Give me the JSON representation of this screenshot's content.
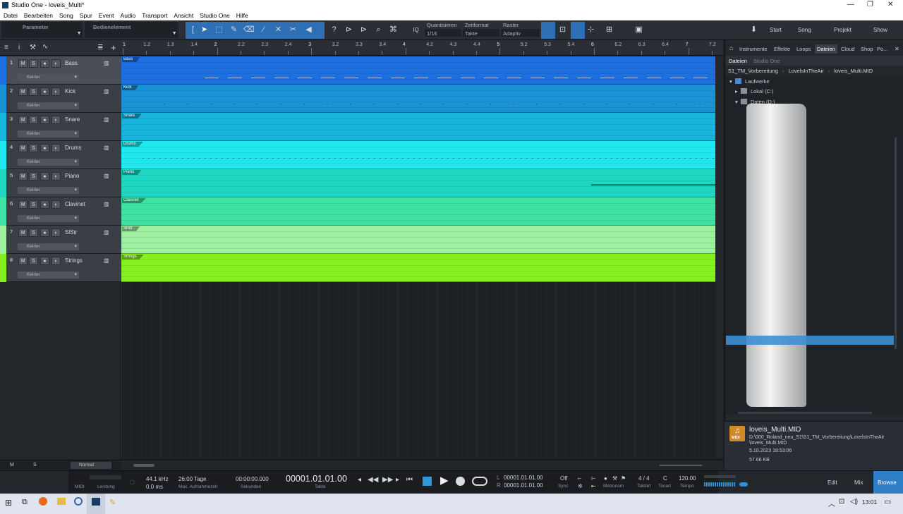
{
  "window": {
    "title": "Studio One - loveis_Multi*",
    "controls": [
      "—",
      "❐",
      "✕"
    ]
  },
  "menu": [
    "Datei",
    "Bearbeiten",
    "Song",
    "Spur",
    "Event",
    "Audio",
    "Transport",
    "Ansicht",
    "Studio One",
    "Hilfe"
  ],
  "toolbar": {
    "parameter_label": "Parameter",
    "bedienelement_label": "Bedienelement",
    "quantize": {
      "label": "Quantisieren",
      "value": "1/16"
    },
    "timeformat": {
      "label": "Zeitformat",
      "value": "Takte"
    },
    "grid": {
      "label": "Raster",
      "value": "Adaptiv"
    },
    "iq_label": "IQ",
    "nav": [
      "Start",
      "Song",
      "Projekt",
      "Show"
    ]
  },
  "tracks": [
    {
      "num": "1",
      "name": "Bass",
      "input": "Keiner",
      "color": "#1e6fe0"
    },
    {
      "num": "2",
      "name": "Kick",
      "input": "Keiner",
      "color": "#1a93d6"
    },
    {
      "num": "3",
      "name": "Snare",
      "input": "Keiner",
      "color": "#17b4dc"
    },
    {
      "num": "4",
      "name": "Drums",
      "input": "Keiner",
      "color": "#1fe8ef"
    },
    {
      "num": "5",
      "name": "Piano",
      "input": "Keiner",
      "color": "#1ed7c2"
    },
    {
      "num": "6",
      "name": "Clavinet",
      "input": "Keiner",
      "color": "#3ee2a3"
    },
    {
      "num": "7",
      "name": "SlStr",
      "input": "Keiner",
      "color": "#9ff0a0"
    },
    {
      "num": "8",
      "name": "Strings",
      "input": "Keiner",
      "color": "#86f01f"
    }
  ],
  "track_buttons": [
    "M",
    "S",
    "●",
    "◐"
  ],
  "ruler_ticks": [
    "1",
    "1.2",
    "1.3",
    "1.4",
    "2",
    "2.2",
    "2.3",
    "2.4",
    "3",
    "3.2",
    "3.3",
    "3.4",
    "4",
    "4.2",
    "4.3",
    "4.4",
    "5",
    "5.2",
    "5.3",
    "5.4",
    "6",
    "6.2",
    "6.3",
    "6.4",
    "7",
    "7.2"
  ],
  "browser": {
    "tabs": [
      "Instrumente",
      "Effekte",
      "Loops",
      "Dateien",
      "Cloud",
      "Shop",
      "Po..."
    ],
    "selected_tab": "Dateien",
    "subtabs": [
      "Dateien",
      "Studio One"
    ],
    "breadcrumb": [
      "S1_TM_Vorbereitung",
      "LovelsInTheAir",
      "loveis_Multi.MID"
    ],
    "tree": [
      "Laufwerke",
      "Lokal (C:)",
      "Daten (D:)"
    ],
    "file": {
      "name": "loveis_Multi.MID",
      "path1": "D:\\000_Roland_neu_S1\\S1_TM_Vorbereitung\\LovelsInTheAir",
      "path2": "\\loveis_Multi.MID",
      "date": "5.10.2023 18:53:06",
      "size": "57.66 KB",
      "badge": "MIDI"
    }
  },
  "statusrow": {
    "m": "M",
    "s": "S",
    "mode": "Normal"
  },
  "transport": {
    "midi": "MIDI",
    "leistung": "Leistung",
    "samplerate": "44.1 kHz",
    "latency": "0.0 ms",
    "record_time": "26:00 Tage",
    "record_label": "Max. Aufnahmezeit",
    "seconds": "00:00:00.000",
    "seconds_label": "Sekunden",
    "position": "00001.01.01.00",
    "position_label": "Takte",
    "loop_l": "00001.01.01.00",
    "loop_r": "00001.01.01.00",
    "l": "L",
    "r": "R",
    "sync_value": "Off",
    "sync_label": "Sync",
    "metronom_label": "Metronom",
    "signature": "4 / 4",
    "signature_label": "Taktart",
    "key": "C",
    "key_label": "Tonart",
    "tempo": "120.00",
    "tempo_label": "Tempo",
    "views": [
      "Edit",
      "Mix",
      "Browse"
    ]
  },
  "taskbar": {
    "time": "13:01"
  }
}
